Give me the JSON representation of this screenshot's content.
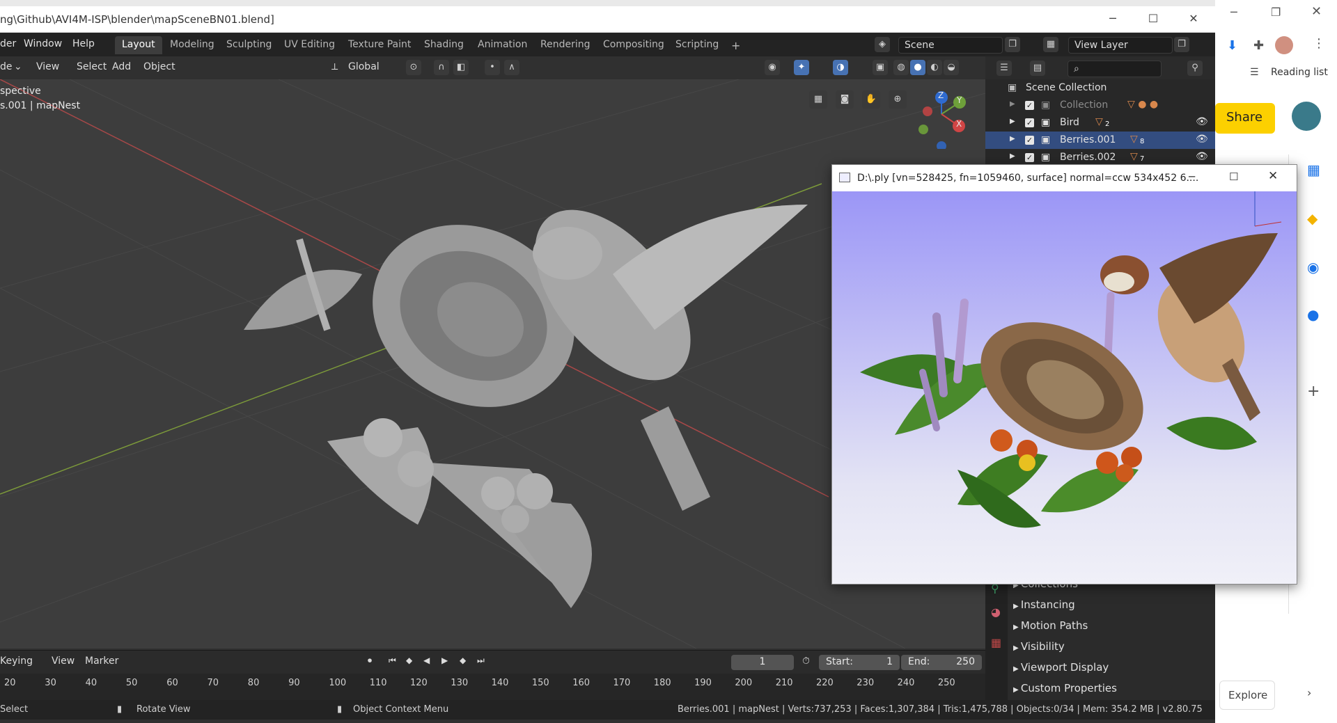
{
  "window": {
    "title": "ng\\Github\\AVI4M-ISP\\blender\\mapSceneBN01.blend]",
    "minimize": "─",
    "maximize": "☐",
    "close": "✕"
  },
  "menubar": {
    "items": [
      "der",
      "Window",
      "Help"
    ],
    "workspaces": [
      "Layout",
      "Modeling",
      "Sculpting",
      "UV Editing",
      "Texture Paint",
      "Shading",
      "Animation",
      "Rendering",
      "Compositing",
      "Scripting"
    ],
    "add_tab": "+",
    "scene": "Scene",
    "view_layer": "View Layer"
  },
  "viewport_header": {
    "mode": "de",
    "menus": [
      "View",
      "Select",
      "Add",
      "Object"
    ],
    "transform": "Global"
  },
  "viewport": {
    "perspective": "spective",
    "object_info": "s.001 | mapNest",
    "gizmo_axes": [
      "Z",
      "Y",
      "X"
    ]
  },
  "outliner": {
    "rows": [
      {
        "label": "Scene Collection",
        "selected": false,
        "dim": false
      },
      {
        "label": "Collection",
        "selected": false,
        "dim": true
      },
      {
        "label": "Bird",
        "selected": false,
        "dim": false,
        "badge": "2"
      },
      {
        "label": "Berries.001",
        "selected": true,
        "dim": false,
        "badge": "8"
      },
      {
        "label": "Berries.002",
        "selected": false,
        "dim": false,
        "badge": "7"
      }
    ]
  },
  "properties": {
    "rows": [
      "Collections",
      "Instancing",
      "Motion Paths",
      "Visibility",
      "Viewport Display",
      "Custom Properties"
    ]
  },
  "timeline": {
    "keying": "Keying",
    "menus": [
      "View",
      "Marker"
    ],
    "current_frame": "1",
    "start_label": "Start:",
    "start": "1",
    "end_label": "End:",
    "end": "250",
    "ticks": [
      "20",
      "30",
      "40",
      "50",
      "60",
      "70",
      "80",
      "90",
      "100",
      "110",
      "120",
      "130",
      "140",
      "150",
      "160",
      "170",
      "180",
      "190",
      "200",
      "210",
      "220",
      "230",
      "240",
      "250"
    ]
  },
  "statusbar": {
    "select": "Select",
    "rotate": "Rotate View",
    "context": "Object Context Menu",
    "stats": "Berries.001 | mapNest | Verts:737,253 | Faces:1,307,384 | Tris:1,475,788 | Objects:0/34 | Mem: 354.2 MB | v2.80.75"
  },
  "viewer": {
    "title": "D:\\.ply [vn=528425, fn=1059460, surface]  normal=ccw   534x452 6...."
  },
  "chrome": {
    "reading_list": "Reading list",
    "share": "Share",
    "explore": "Explore"
  }
}
